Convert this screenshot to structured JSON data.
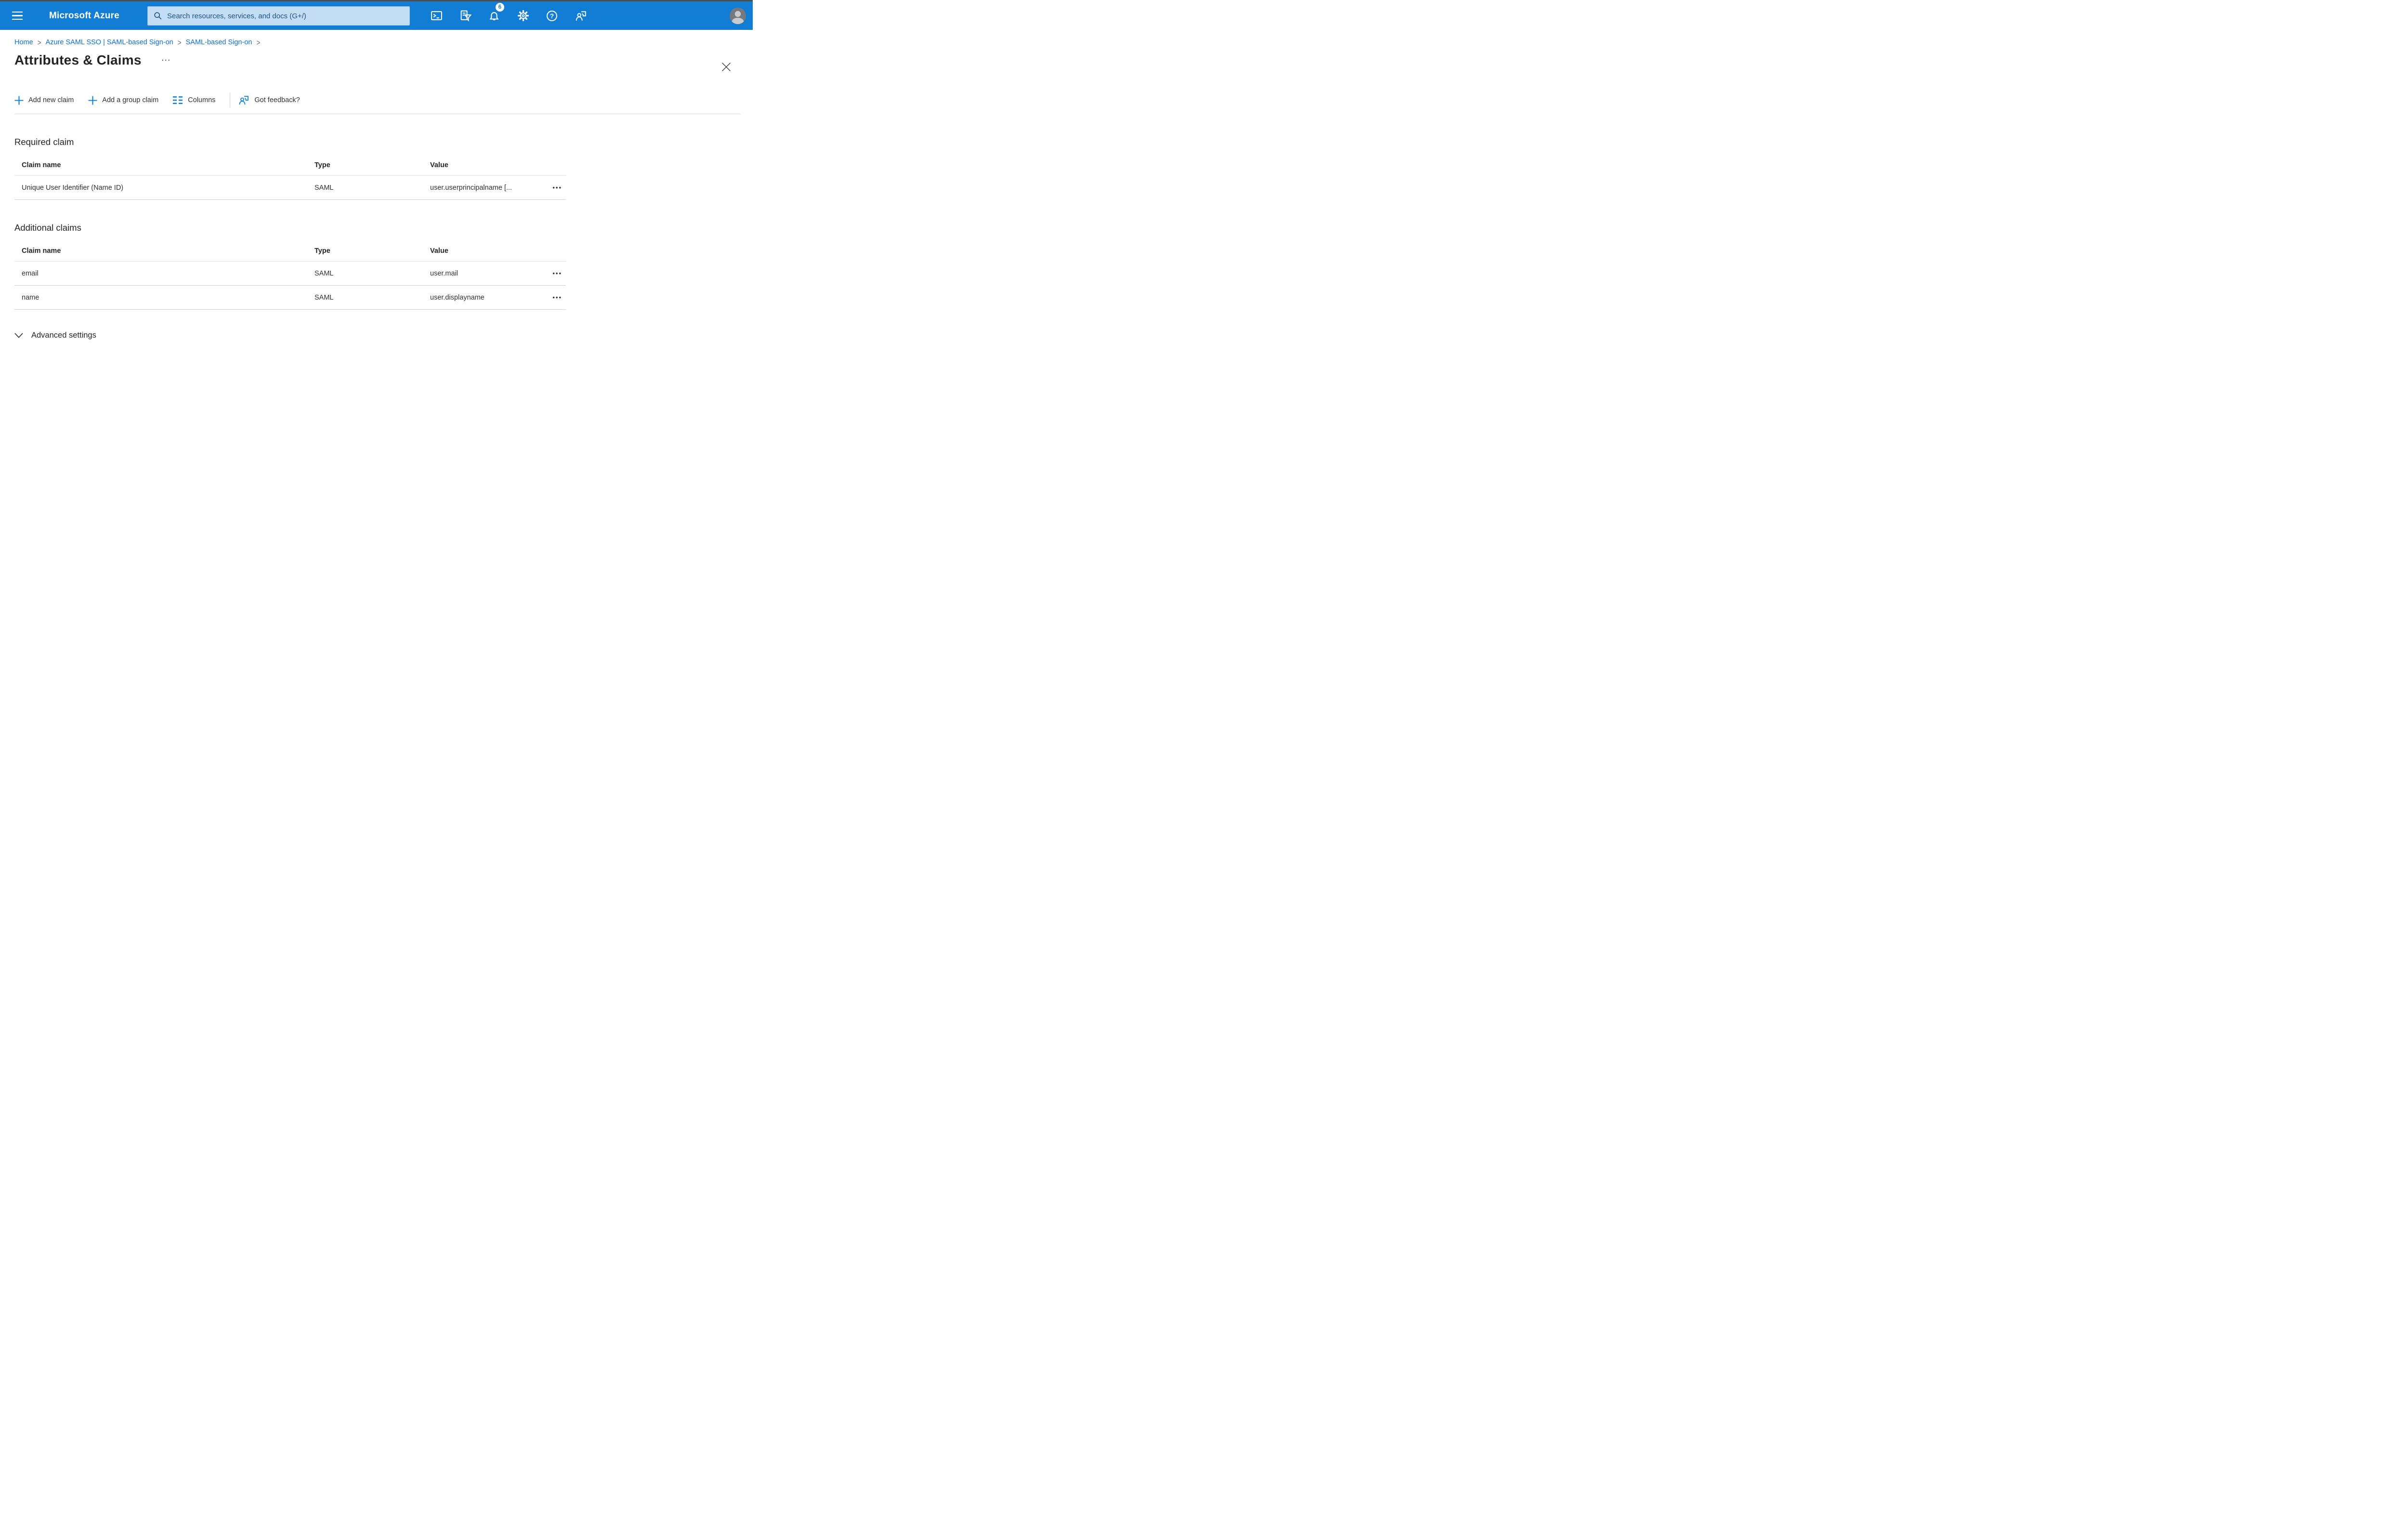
{
  "colors": {
    "topbar_bg": "#127dd4",
    "search_bg": "#c3ddf4",
    "search_text": "#19538c",
    "link_blue": "#0b6ed1",
    "icon_blue": "#1181d8",
    "text_dark": "#252423",
    "divider": "#d2d0ce"
  },
  "topbar": {
    "brand": "Microsoft Azure",
    "search_placeholder": "Search resources, services, and docs (G+/)",
    "notification_count": "6"
  },
  "breadcrumb": {
    "separator": ">",
    "items": [
      {
        "label": "Home"
      },
      {
        "label": "Azure SAML SSO | SAML-based Sign-on"
      },
      {
        "label": "SAML-based Sign-on"
      }
    ]
  },
  "page": {
    "title": "Attributes & Claims"
  },
  "ui": {
    "title_dots": "···",
    "row_actions": "•••"
  },
  "toolbar": {
    "add_new_claim": "Add new claim",
    "add_group_claim": "Add a group claim",
    "columns": "Columns",
    "got_feedback": "Got feedback?"
  },
  "required_claim": {
    "heading": "Required claim",
    "columns": [
      "Claim name",
      "Type",
      "Value"
    ],
    "rows": [
      {
        "claim_name": "Unique User Identifier (Name ID)",
        "type": "SAML",
        "value": "user.userprincipalname [..."
      }
    ]
  },
  "additional_claims": {
    "heading": "Additional claims",
    "columns": [
      "Claim name",
      "Type",
      "Value"
    ],
    "rows": [
      {
        "claim_name": "email",
        "type": "SAML",
        "value": "user.mail"
      },
      {
        "claim_name": "name",
        "type": "SAML",
        "value": "user.displayname"
      }
    ]
  },
  "advanced_settings": {
    "label": "Advanced settings"
  }
}
